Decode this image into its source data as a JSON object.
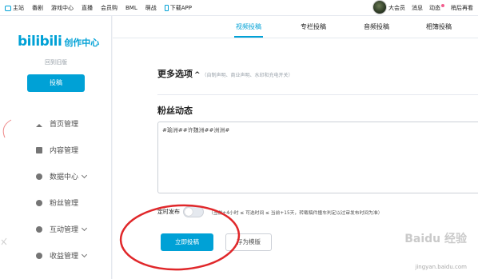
{
  "topbar": {
    "nav": [
      "主站",
      "番剧",
      "游戏中心",
      "直播",
      "会员购",
      "BML",
      "萌战",
      "下载APP"
    ],
    "right": [
      "大会员",
      "消息",
      "动态",
      "稍后再看"
    ]
  },
  "sidebar": {
    "logo": "bilibili",
    "logo_suffix": "创作中心",
    "old_version": "回到旧版",
    "submit_label": "投稿",
    "menu": [
      {
        "label": "首页管理",
        "icon": "home-icon",
        "has_chevron": false
      },
      {
        "label": "内容管理",
        "icon": "document-icon",
        "has_chevron": false
      },
      {
        "label": "数据中心",
        "icon": "data-icon",
        "has_chevron": true
      },
      {
        "label": "粉丝管理",
        "icon": "fans-icon",
        "has_chevron": false
      },
      {
        "label": "互动管理",
        "icon": "interaction-icon",
        "has_chevron": true
      },
      {
        "label": "收益管理",
        "icon": "income-icon",
        "has_chevron": true
      }
    ]
  },
  "tabs": [
    {
      "label": "视频投稿",
      "active": true
    },
    {
      "label": "专栏投稿",
      "active": false
    },
    {
      "label": "音频投稿",
      "active": false
    },
    {
      "label": "相簿投稿",
      "active": false
    }
  ],
  "more_options": {
    "title": "更多选项",
    "caret": "^",
    "hint": "（自制声明、商业声明、水印和充电开关）"
  },
  "fans_dynamic": {
    "title": "粉丝动态",
    "value": "#瑜洲##许魏洲##洲洲#"
  },
  "timer": {
    "label": "定时发布",
    "enabled": false,
    "note": "（当前+4小时 ≤ 可选时间 ≤ 当前+15天，转载稿件撞车判定以过审发布时间为准）"
  },
  "actions": {
    "submit": "立即投稿",
    "save_template": "存为模版"
  },
  "watermark": {
    "text": "Baidu 经验",
    "url": "jingyan.baidu.com"
  },
  "colors": {
    "accent": "#00a1d6",
    "annotation": "#e0272a"
  }
}
